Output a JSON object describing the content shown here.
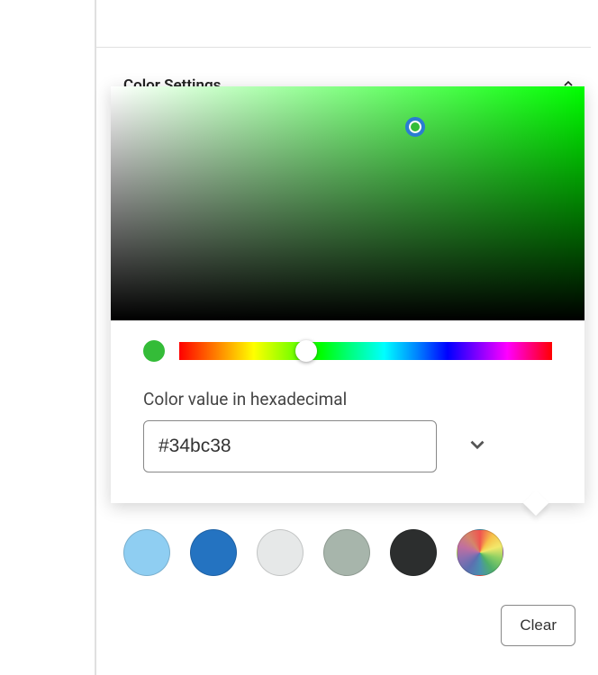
{
  "section": {
    "title": "Color Settings"
  },
  "picker": {
    "hex_label": "Color value in hexadecimal",
    "hex_value": "#34bc38",
    "current_color": "#34bc38"
  },
  "swatches": [
    {
      "name": "swatch-light-blue",
      "color": "#8fcef2"
    },
    {
      "name": "swatch-blue",
      "color": "#2473c1"
    },
    {
      "name": "swatch-light-gray",
      "color": "#e6e8e8"
    },
    {
      "name": "swatch-sage",
      "color": "#a7b5ab"
    },
    {
      "name": "swatch-dark-gray",
      "color": "#2c2e2e"
    },
    {
      "name": "swatch-custom",
      "color": "conic"
    }
  ],
  "buttons": {
    "clear": "Clear"
  }
}
